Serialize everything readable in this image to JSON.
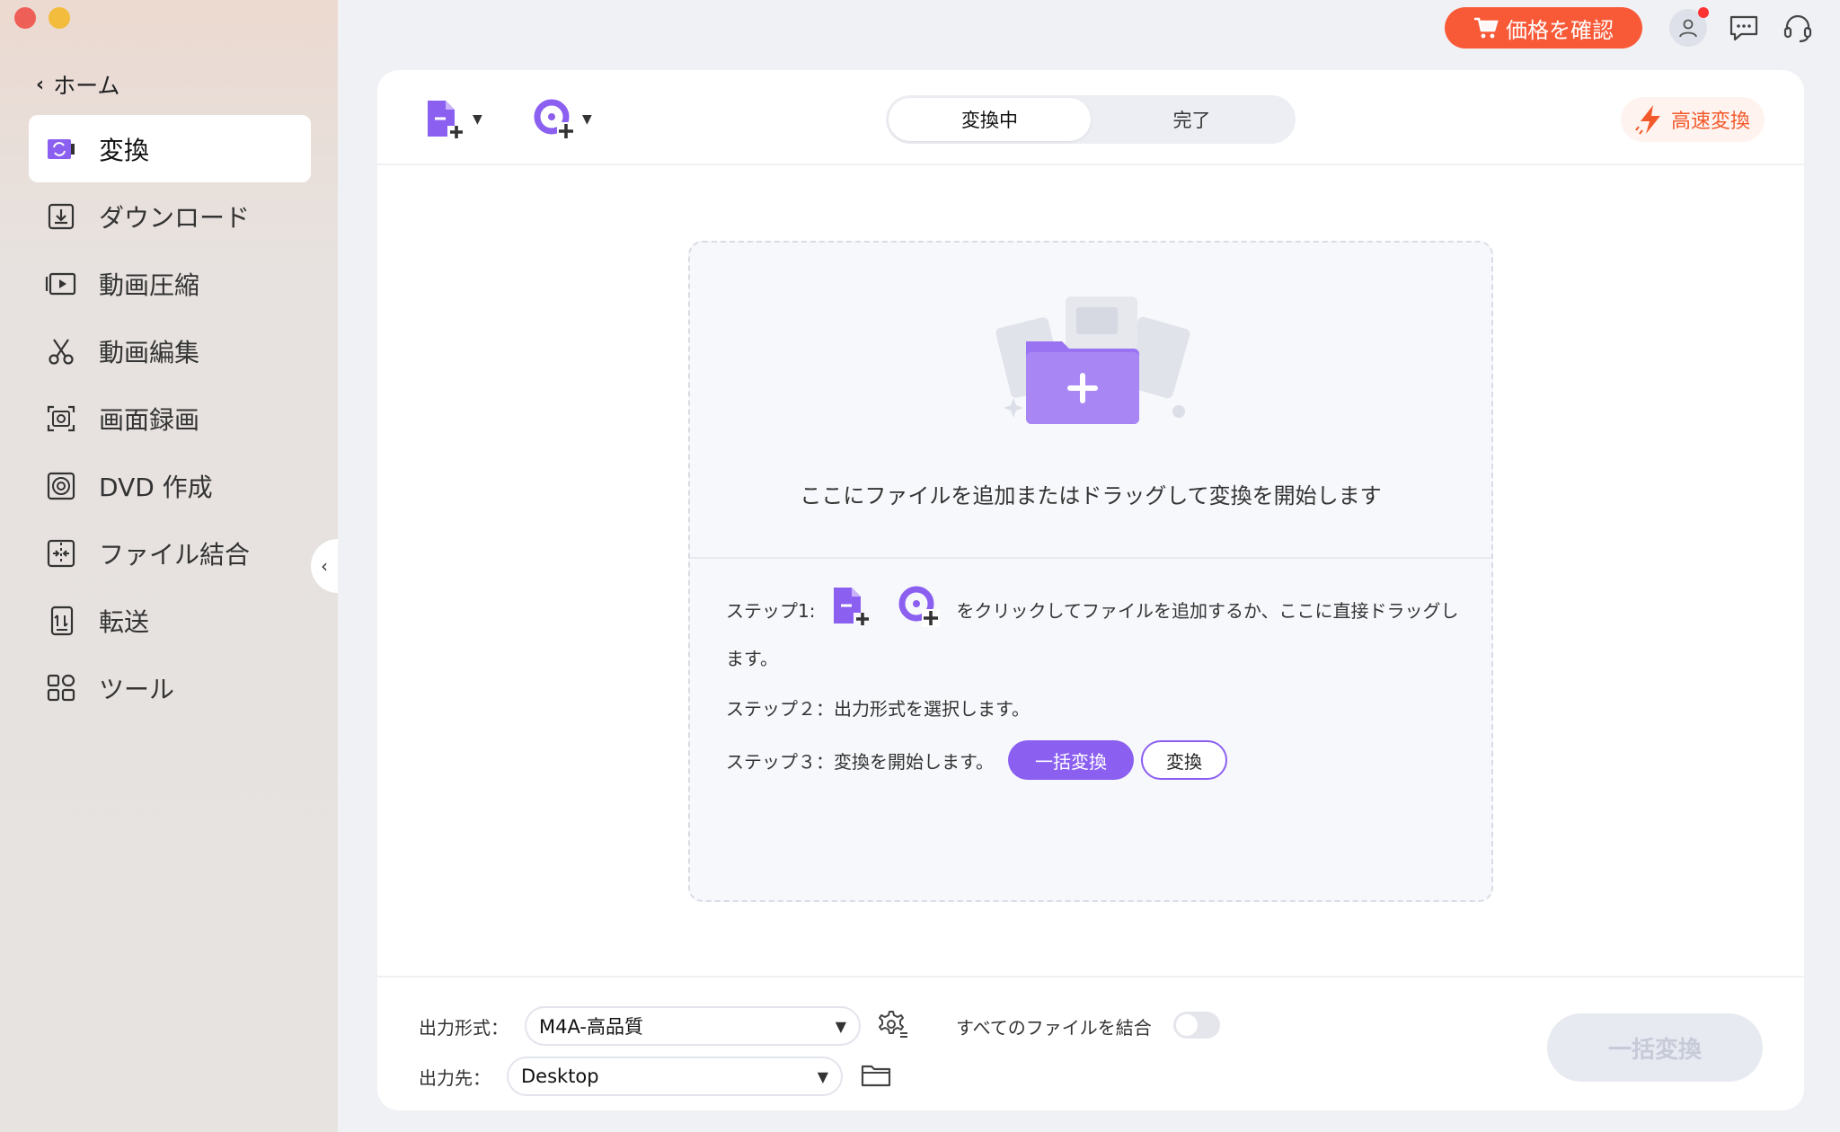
{
  "app": {
    "home_label": "ホーム"
  },
  "sidebar": {
    "items": [
      {
        "label": "変換",
        "icon": "convert-icon",
        "active": true
      },
      {
        "label": "ダウンロード",
        "icon": "download-icon"
      },
      {
        "label": "動画圧縮",
        "icon": "compress-icon"
      },
      {
        "label": "動画編集",
        "icon": "scissors-icon"
      },
      {
        "label": "画面録画",
        "icon": "screen-record-icon"
      },
      {
        "label": "DVD 作成",
        "icon": "dvd-icon"
      },
      {
        "label": "ファイル結合",
        "icon": "merge-icon"
      },
      {
        "label": "転送",
        "icon": "transfer-icon"
      },
      {
        "label": "ツール",
        "icon": "tools-icon"
      }
    ]
  },
  "header": {
    "price_button": "価格を確認"
  },
  "toolbar": {
    "tabs": [
      "変換中",
      "完了"
    ],
    "fast_convert": "高速変換"
  },
  "dropzone": {
    "main_text": "ここにファイルを追加またはドラッグして変換を開始します",
    "step1_prefix": "ステップ1:",
    "step1_suffix": "をクリックしてファイルを追加するか、ここに直接ドラッグします。",
    "step2": "ステップ２：出力形式を選択します。",
    "step3": "ステップ３：変換を開始します。",
    "batch_label": "一括変換",
    "convert_label": "変換"
  },
  "footer": {
    "output_format_label": "出力形式：",
    "output_format_value": "M4A-高品質",
    "output_dest_label": "出力先：",
    "output_dest_value": "Desktop",
    "merge_label": "すべてのファイルを結合",
    "batch_button": "一括変換"
  },
  "colors": {
    "accent": "#8b5ff0",
    "price": "#f85a38",
    "fast": "#f25a2c"
  }
}
